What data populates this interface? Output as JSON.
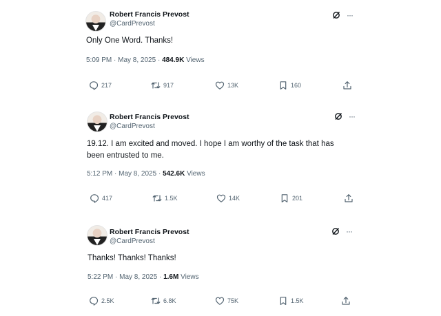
{
  "tweets": [
    {
      "author": "Robert Francis Prevost",
      "handle": "@CardPrevost",
      "text": "Only One Word. Thanks!",
      "time": "5:09 PM · May 8, 2025 · ",
      "views_count": "484.9K",
      "views_label": " Views",
      "replies": "217",
      "reposts": "917",
      "likes": "13K",
      "bookmarks": "160"
    },
    {
      "author": "Robert Francis Prevost",
      "handle": "@CardPrevost",
      "text": "19.12. I am excited and moved. I hope I am worthy of the task that has been entrusted to me.",
      "time": "5:12 PM · May 8, 2025 · ",
      "views_count": "542.6K",
      "views_label": " Views",
      "replies": "417",
      "reposts": "1.5K",
      "likes": "14K",
      "bookmarks": "201"
    },
    {
      "author": "Robert Francis Prevost",
      "handle": "@CardPrevost",
      "text": "Thanks! Thanks! Thanks!",
      "time": "5:22 PM · May 8, 2025 · ",
      "views_count": "1.6M",
      "views_label": " Views",
      "replies": "2.5K",
      "reposts": "6.8K",
      "likes": "75K",
      "bookmarks": "1.5K"
    }
  ],
  "icons": {
    "grok": "grok-icon",
    "more": "more-icon",
    "reply": "reply-icon",
    "repost": "repost-icon",
    "like": "like-icon",
    "bookmark": "bookmark-icon",
    "share": "share-icon"
  },
  "more_glyph": "···"
}
